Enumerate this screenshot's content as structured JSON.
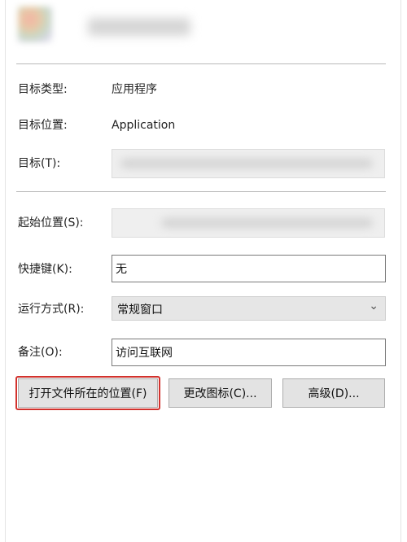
{
  "dialog": {
    "target_type_label": "目标类型:",
    "target_type_value": "应用程序",
    "target_location_label": "目标位置:",
    "target_location_value": "Application",
    "target_label": "目标(T):",
    "start_in_label": "起始位置(S):",
    "shortcut_key_label": "快捷键(K):",
    "shortcut_key_value": "无",
    "run_label": "运行方式(R):",
    "run_value": "常规窗口",
    "comment_label": "备注(O):",
    "comment_value": "访问互联网"
  },
  "buttons": {
    "open_location": "打开文件所在的位置(F)",
    "change_icon": "更改图标(C)...",
    "advanced": "高级(D)..."
  },
  "colors": {
    "highlight": "#d2322d",
    "button_bg": "#e3e3e3"
  },
  "icons": {
    "dropdown": "chevron-down-icon"
  }
}
